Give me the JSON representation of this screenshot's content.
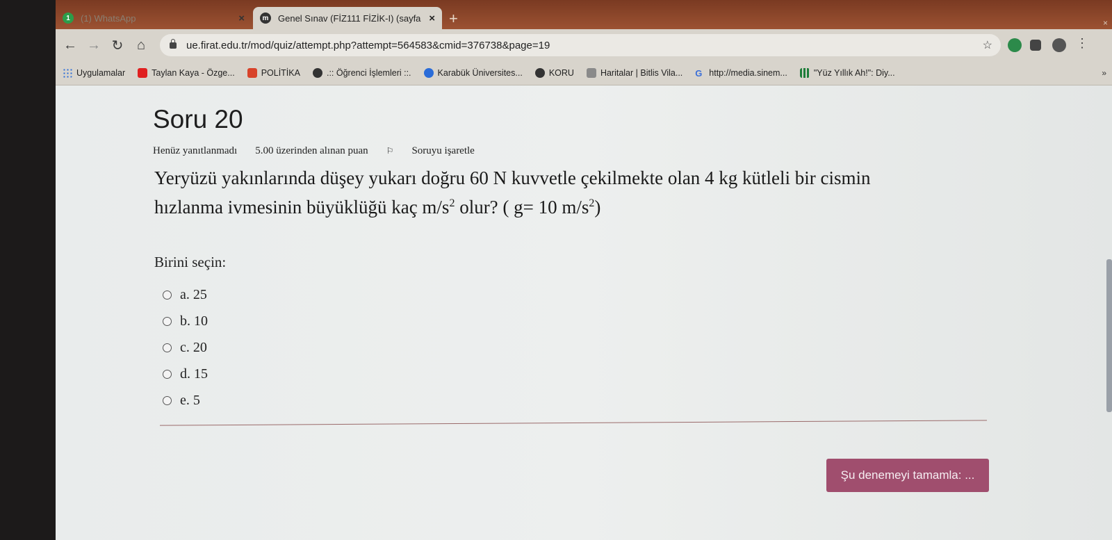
{
  "browser": {
    "tabs": [
      {
        "title": "(1) WhatsApp",
        "favicon": "1"
      },
      {
        "title": "Genel Sınav (FİZ111 FİZİK-I) (sayfa",
        "favicon": "m"
      }
    ],
    "new_tab": "+",
    "close_glyph": "×",
    "url": "ue.firat.edu.tr/mod/quiz/attempt.php?attempt=564583&cmid=376738&page=19"
  },
  "bookmarks": [
    {
      "label": "Uygulamalar",
      "icon": "apps-grid-icon",
      "color": "#2a6cd8"
    },
    {
      "label": "Taylan Kaya - Özge...",
      "icon": "youtube-icon",
      "color": "#e02020"
    },
    {
      "label": "POLİTİKA",
      "icon": "r-logo-icon",
      "color": "#d8432a"
    },
    {
      "label": ".:: Öğrenci İşlemleri ::.",
      "icon": "globe-icon",
      "color": "#333333"
    },
    {
      "label": "Karabük Üniversites...",
      "icon": "circle-logo-icon",
      "color": "#2a6cd8"
    },
    {
      "label": "KORU",
      "icon": "globe-icon",
      "color": "#333333"
    },
    {
      "label": "Haritalar | Bitlis Vila...",
      "icon": "map-logo-icon",
      "color": "#8a8a8a"
    },
    {
      "label": "http://media.sinem...",
      "icon": "google-icon",
      "color": "#3b6fd8"
    },
    {
      "label": "\"Yüz Yıllık Ah!\": Diy...",
      "icon": "bars-icon",
      "color": "#1e7d3a"
    }
  ],
  "bookmarks_more": "»",
  "question": {
    "heading": "Soru 20",
    "status": "Henüz yanıtlanmadı",
    "points": "5.00 üzerinden alınan puan",
    "flag_label": "Soruyu işaretle",
    "text_line1": "Yeryüzü yakınlarında düşey yukarı doğru 60 N kuvvetle çekilmekte olan 4 kg kütleli bir cismin",
    "text_line2_a": "hızlanma ivmesinin büyüklüğü kaç m/s",
    "text_line2_b": " olur? ( g= 10 m/s",
    "text_line2_c": ")",
    "sup": "2",
    "prompt": "Birini seçin:",
    "answers": [
      "a. 25",
      "b. 10",
      "c. 20",
      "d. 15",
      "e. 5"
    ]
  },
  "finish_button": "Şu denemeyi tamamla: ..."
}
